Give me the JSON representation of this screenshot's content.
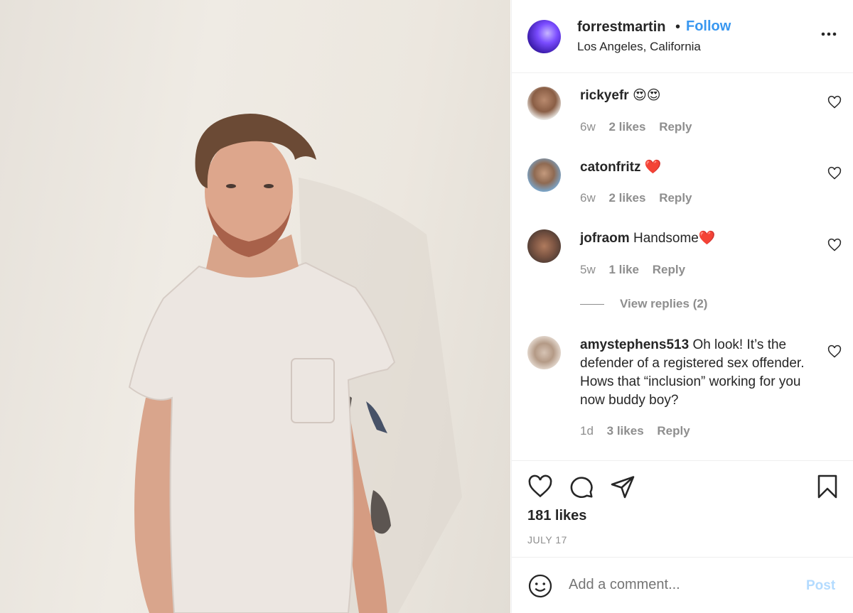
{
  "post": {
    "username": "forrestmartin",
    "separator": "•",
    "follow_label": "Follow",
    "location": "Los Angeles, California",
    "more_icon": "more-options-icon"
  },
  "comments": [
    {
      "username": "rickyefr",
      "text": "😍😍",
      "age": "6w",
      "likes": "2 likes",
      "reply": "Reply"
    },
    {
      "username": "catonfritz",
      "text": "❤️",
      "age": "6w",
      "likes": "2 likes",
      "reply": "Reply"
    },
    {
      "username": "jofraom",
      "text": "Handsome❤️",
      "age": "5w",
      "likes": "1 like",
      "reply": "Reply"
    },
    {
      "username": "amystephens513",
      "text": "Oh look! It’s the defender of a registered sex offender. Hows that “inclusion” working for you now buddy boy?",
      "age": "1d",
      "likes": "3 likes",
      "reply": "Reply"
    }
  ],
  "view_replies": "View replies (2)",
  "actions": {
    "likes": "181 likes",
    "date": "JULY 17"
  },
  "add_comment": {
    "placeholder": "Add a comment...",
    "post_label": "Post"
  },
  "colors": {
    "link": "#3897f0",
    "muted": "#8e8e8e",
    "post_disabled": "#b3dbff",
    "heart": "#ed4956"
  }
}
